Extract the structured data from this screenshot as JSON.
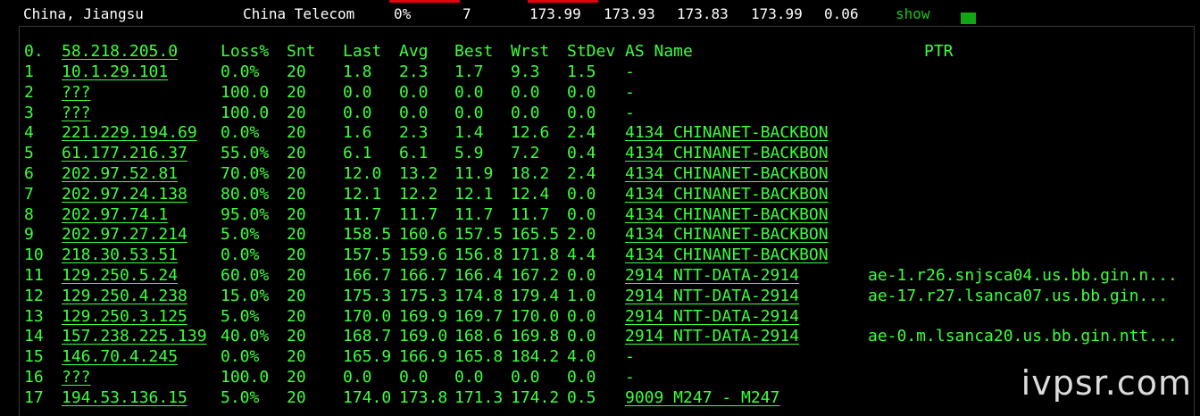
{
  "summary": {
    "location": "China, Jiangsu",
    "isp": "China Telecom",
    "loss": "0%",
    "sent": "7",
    "last": "173.99",
    "avg": "173.93",
    "best": "173.83",
    "worst": "173.99",
    "stdev": "0.06",
    "show_label": "show",
    "colors": {
      "accent_red": "#e3000f",
      "link_green": "#1ec51e",
      "square_green": "#14a514"
    }
  },
  "mtr": {
    "header": {
      "num": "0.",
      "host": "58.218.205.0",
      "loss": "Loss%",
      "snt": "Snt",
      "last": "Last",
      "avg": "Avg",
      "best": "Best",
      "wrst": "Wrst",
      "stdev": "StDev",
      "as_name": "AS Name",
      "ptr": "PTR"
    },
    "rows": [
      {
        "num": "1",
        "host": "10.1.29.101",
        "loss": "0.0%",
        "snt": "20",
        "last": "1.8",
        "avg": "2.3",
        "best": "1.7",
        "wrst": "9.3",
        "stdev": "1.5",
        "as": "-",
        "ptr": ""
      },
      {
        "num": "2",
        "host": "???",
        "loss": "100.0",
        "snt": "20",
        "last": "0.0",
        "avg": "0.0",
        "best": "0.0",
        "wrst": "0.0",
        "stdev": "0.0",
        "as": "-",
        "ptr": ""
      },
      {
        "num": "3",
        "host": "???",
        "loss": "100.0",
        "snt": "20",
        "last": "0.0",
        "avg": "0.0",
        "best": "0.0",
        "wrst": "0.0",
        "stdev": "0.0",
        "as": "-",
        "ptr": ""
      },
      {
        "num": "4",
        "host": "221.229.194.69",
        "loss": "0.0%",
        "snt": "20",
        "last": "1.6",
        "avg": "2.3",
        "best": "1.4",
        "wrst": "12.6",
        "stdev": "2.4",
        "as": "4134  CHINANET-BACKBON",
        "ptr": ""
      },
      {
        "num": "5",
        "host": "61.177.216.37",
        "loss": "55.0%",
        "snt": "20",
        "last": "6.1",
        "avg": "6.1",
        "best": "5.9",
        "wrst": "7.2",
        "stdev": "0.4",
        "as": "4134  CHINANET-BACKBON",
        "ptr": ""
      },
      {
        "num": "6",
        "host": "202.97.52.81",
        "loss": "70.0%",
        "snt": "20",
        "last": "12.0",
        "avg": "13.2",
        "best": "11.9",
        "wrst": "18.2",
        "stdev": "2.4",
        "as": "4134  CHINANET-BACKBON",
        "ptr": ""
      },
      {
        "num": "7",
        "host": "202.97.24.138",
        "loss": "80.0%",
        "snt": "20",
        "last": "12.1",
        "avg": "12.2",
        "best": "12.1",
        "wrst": "12.4",
        "stdev": "0.0",
        "as": "4134  CHINANET-BACKBON",
        "ptr": ""
      },
      {
        "num": "8",
        "host": "202.97.74.1",
        "loss": "95.0%",
        "snt": "20",
        "last": "11.7",
        "avg": "11.7",
        "best": "11.7",
        "wrst": "11.7",
        "stdev": "0.0",
        "as": "4134  CHINANET-BACKBON",
        "ptr": ""
      },
      {
        "num": "9",
        "host": "202.97.27.214",
        "loss": "5.0%",
        "snt": "20",
        "last": "158.5",
        "avg": "160.6",
        "best": "157.5",
        "wrst": "165.5",
        "stdev": "2.0",
        "as": "4134  CHINANET-BACKBON",
        "ptr": ""
      },
      {
        "num": "10",
        "host": "218.30.53.51",
        "loss": "0.0%",
        "snt": "20",
        "last": "157.5",
        "avg": "159.6",
        "best": "156.8",
        "wrst": "171.8",
        "stdev": "4.4",
        "as": "4134  CHINANET-BACKBON",
        "ptr": ""
      },
      {
        "num": "11",
        "host": "129.250.5.24",
        "loss": "60.0%",
        "snt": "20",
        "last": "166.7",
        "avg": "166.7",
        "best": "166.4",
        "wrst": "167.2",
        "stdev": "0.0",
        "as": "2914  NTT-DATA-2914",
        "ptr": "ae-1.r26.snjsca04.us.bb.gin.n..."
      },
      {
        "num": "12",
        "host": "129.250.4.238",
        "loss": "15.0%",
        "snt": "20",
        "last": "175.3",
        "avg": "175.3",
        "best": "174.8",
        "wrst": "179.4",
        "stdev": "1.0",
        "as": "2914  NTT-DATA-2914",
        "ptr": "ae-17.r27.lsanca07.us.bb.gin..."
      },
      {
        "num": "13",
        "host": "129.250.3.125",
        "loss": "5.0%",
        "snt": "20",
        "last": "170.0",
        "avg": "169.9",
        "best": "169.7",
        "wrst": "170.0",
        "stdev": "0.0",
        "as": "2914  NTT-DATA-2914",
        "ptr": ""
      },
      {
        "num": "14",
        "host": "157.238.225.139",
        "loss": "40.0%",
        "snt": "20",
        "last": "168.7",
        "avg": "169.0",
        "best": "168.6",
        "wrst": "169.8",
        "stdev": "0.0",
        "as": "2914  NTT-DATA-2914",
        "ptr": "ae-0.m.lsanca20.us.bb.gin.ntt..."
      },
      {
        "num": "15",
        "host": "146.70.4.245",
        "loss": "0.0%",
        "snt": "20",
        "last": "165.9",
        "avg": "166.9",
        "best": "165.8",
        "wrst": "184.2",
        "stdev": "4.0",
        "as": "-",
        "ptr": ""
      },
      {
        "num": "16",
        "host": "???",
        "loss": "100.0",
        "snt": "20",
        "last": "0.0",
        "avg": "0.0",
        "best": "0.0",
        "wrst": "0.0",
        "stdev": "0.0",
        "as": "-",
        "ptr": ""
      },
      {
        "num": "17",
        "host": "194.53.136.15",
        "loss": "5.0%",
        "snt": "20",
        "last": "174.0",
        "avg": "173.8",
        "best": "171.3",
        "wrst": "174.2",
        "stdev": "0.5",
        "as": "9009  M247 - M247",
        "ptr": ""
      }
    ]
  },
  "watermark": "ivpsr.com"
}
